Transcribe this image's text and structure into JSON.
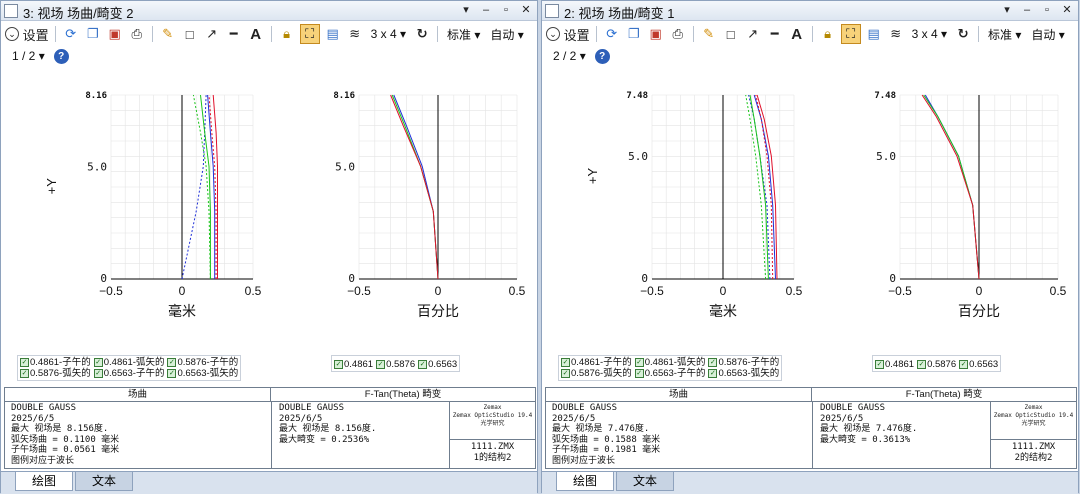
{
  "windows": [
    {
      "title": "3: 视场 场曲/畸变 2",
      "toolbar": {
        "settings_label": "设置",
        "grid_label": "3 x 4",
        "standard_label": "标准",
        "auto_label": "自动"
      },
      "page_label": "1 / 2",
      "plots": {
        "field_max_label": "8.16",
        "mid_label": "5.0",
        "zero_label": "0",
        "y_axis_label": "+Y",
        "left_xlabel": "毫米",
        "right_xlabel": "百分比",
        "tick_min": "−0.5",
        "tick_zero": "0",
        "tick_max": "0.5"
      },
      "legend_left": {
        "row1": [
          "0.4861-子午的",
          "0.4861-弧矢的",
          "0.5876-子午的"
        ],
        "row2": [
          "0.5876-弧矢的",
          "0.6563-子午的",
          "0.6563-弧矢的"
        ]
      },
      "legend_right": [
        "0.4861",
        "0.5876",
        "0.6563"
      ],
      "info": {
        "left_header": "场曲",
        "right_header": "F-Tan(Theta) 畸变",
        "left_lines": [
          "DOUBLE GAUSS",
          "2025/6/5",
          "最大 视场是 8.156度.",
          "弧矢场曲 = 0.1100 毫米",
          "子午场曲 = 0.0561 毫米",
          "图例对应于波长"
        ],
        "right_lines": [
          "DOUBLE GAUSS",
          "2025/6/5",
          "最大 视场是 8.156度.",
          "最大畸变 = 0.2536%"
        ],
        "logo_lines": [
          "Zemax",
          "Zemax OpticStudio 19.4",
          "光学研究"
        ],
        "file_lines": [
          "1111.ZMX",
          "1的结构2"
        ]
      },
      "tabs": [
        "绘图",
        "文本"
      ]
    },
    {
      "title": "2: 视场 场曲/畸变 1",
      "toolbar": {
        "settings_label": "设置",
        "grid_label": "3 x 4",
        "standard_label": "标准",
        "auto_label": "自动"
      },
      "page_label": "2 / 2",
      "plots": {
        "field_max_label": "7.48",
        "mid_label": "5.0",
        "zero_label": "0",
        "y_axis_label": "+Y",
        "left_xlabel": "毫米",
        "right_xlabel": "百分比",
        "tick_min": "−0.5",
        "tick_zero": "0",
        "tick_max": "0.5"
      },
      "legend_left": {
        "row1": [
          "0.4861-子午的",
          "0.4861-弧矢的",
          "0.5876-子午的"
        ],
        "row2": [
          "0.5876-弧矢的",
          "0.6563-子午的",
          "0.6563-弧矢的"
        ]
      },
      "legend_right": [
        "0.4861",
        "0.5876",
        "0.6563"
      ],
      "info": {
        "left_header": "场曲",
        "right_header": "F-Tan(Theta) 畸变",
        "left_lines": [
          "DOUBLE GAUSS",
          "2025/6/5",
          "最大 视场是 7.476度.",
          "弧矢场曲 = 0.1588 毫米",
          "子午场曲 = 0.1981 毫米",
          "图例对应于波长"
        ],
        "right_lines": [
          "DOUBLE GAUSS",
          "2025/6/5",
          "最大 视场是 7.476度.",
          "最大畸变 = 0.3613%"
        ],
        "logo_lines": [
          "Zemax",
          "Zemax OpticStudio 19.4",
          "光学研究"
        ],
        "file_lines": [
          "1111.ZMX",
          "2的结构2"
        ]
      },
      "tabs": [
        "绘图",
        "文本"
      ]
    }
  ],
  "colors": {
    "blue": "#1f2fd8",
    "green": "#19c419",
    "red": "#e0102a"
  },
  "chart_data": [
    {
      "type": "line",
      "title": "场曲",
      "xlabel": "毫米",
      "ylabel": "+Y",
      "xlim": [
        -0.5,
        0.5
      ],
      "ylim": [
        0,
        8.16
      ],
      "series": [
        {
          "name": "0.4861-子午的",
          "color": "#1f2fd8",
          "style": "dash",
          "x": [
            0.0,
            0.1,
            0.15,
            0.16,
            0.17
          ],
          "y": [
            0,
            3,
            5,
            6.5,
            8.16
          ]
        },
        {
          "name": "0.4861-弧矢的",
          "color": "#1f2fd8",
          "style": "solid",
          "x": [
            0.23,
            0.23,
            0.22,
            0.2,
            0.18
          ],
          "y": [
            0,
            3,
            5,
            6.5,
            8.16
          ]
        },
        {
          "name": "0.5876-子午的",
          "color": "#19c419",
          "style": "dash",
          "x": [
            0.2,
            0.19,
            0.17,
            0.13,
            0.08
          ],
          "y": [
            0,
            3,
            5,
            6.5,
            8.16
          ]
        },
        {
          "name": "0.5876-弧矢的",
          "color": "#19c419",
          "style": "solid",
          "x": [
            0.2,
            0.2,
            0.19,
            0.16,
            0.13
          ],
          "y": [
            0,
            3,
            5,
            6.5,
            8.16
          ]
        },
        {
          "name": "0.6563-子午的",
          "color": "#e0102a",
          "style": "dash",
          "x": [
            0.24,
            0.24,
            0.23,
            0.21,
            0.19
          ],
          "y": [
            0,
            3,
            5,
            6.5,
            8.16
          ]
        },
        {
          "name": "0.6563-弧矢的",
          "color": "#e0102a",
          "style": "solid",
          "x": [
            0.25,
            0.25,
            0.25,
            0.24,
            0.22
          ],
          "y": [
            0,
            3,
            5,
            6.5,
            8.16
          ]
        }
      ]
    },
    {
      "type": "line",
      "title": "F-Tan(Theta) 畸变",
      "xlabel": "百分比",
      "xlim": [
        -0.5,
        0.5
      ],
      "ylim": [
        0,
        8.16
      ],
      "series": [
        {
          "name": "0.4861",
          "color": "#1f2fd8",
          "x": [
            0,
            -0.03,
            -0.1,
            -0.2,
            -0.28
          ],
          "y": [
            0,
            3,
            5,
            6.8,
            8.16
          ]
        },
        {
          "name": "0.5876",
          "color": "#19c419",
          "x": [
            0,
            -0.03,
            -0.11,
            -0.21,
            -0.29
          ],
          "y": [
            0,
            3,
            5,
            6.8,
            8.16
          ]
        },
        {
          "name": "0.6563",
          "color": "#e0102a",
          "x": [
            0,
            -0.03,
            -0.11,
            -0.22,
            -0.3
          ],
          "y": [
            0,
            3,
            5,
            6.8,
            8.16
          ]
        }
      ]
    },
    {
      "type": "line",
      "title": "场曲",
      "xlabel": "毫米",
      "ylabel": "+Y",
      "xlim": [
        -0.5,
        0.5
      ],
      "ylim": [
        0,
        7.48
      ],
      "series": [
        {
          "name": "0.4861-子午的",
          "color": "#1f2fd8",
          "style": "dash",
          "x": [
            0.33,
            0.31,
            0.26,
            0.22,
            0.18
          ],
          "y": [
            0,
            3,
            5,
            6.5,
            7.48
          ]
        },
        {
          "name": "0.4861-弧矢的",
          "color": "#1f2fd8",
          "style": "solid",
          "x": [
            0.37,
            0.35,
            0.32,
            0.27,
            0.22
          ],
          "y": [
            0,
            3,
            5,
            6.5,
            7.48
          ]
        },
        {
          "name": "0.5876-子午的",
          "color": "#19c419",
          "style": "dash",
          "x": [
            0.3,
            0.27,
            0.23,
            0.19,
            0.16
          ],
          "y": [
            0,
            3,
            5,
            6.5,
            7.48
          ]
        },
        {
          "name": "0.5876-弧矢的",
          "color": "#19c419",
          "style": "solid",
          "x": [
            0.32,
            0.3,
            0.26,
            0.22,
            0.19
          ],
          "y": [
            0,
            3,
            5,
            6.5,
            7.48
          ]
        },
        {
          "name": "0.6563-子午的",
          "color": "#e0102a",
          "style": "dash",
          "x": [
            0.35,
            0.34,
            0.31,
            0.27,
            0.23
          ],
          "y": [
            0,
            3,
            5,
            6.5,
            7.48
          ]
        },
        {
          "name": "0.6563-弧矢的",
          "color": "#e0102a",
          "style": "solid",
          "x": [
            0.38,
            0.37,
            0.34,
            0.29,
            0.24
          ],
          "y": [
            0,
            3,
            5,
            6.5,
            7.48
          ]
        }
      ]
    },
    {
      "type": "line",
      "title": "F-Tan(Theta) 畸变",
      "xlabel": "百分比",
      "xlim": [
        -0.5,
        0.5
      ],
      "ylim": [
        0,
        7.48
      ],
      "series": [
        {
          "name": "0.4861",
          "color": "#1f2fd8",
          "x": [
            0,
            -0.04,
            -0.13,
            -0.26,
            -0.34
          ],
          "y": [
            0,
            3,
            5,
            6.6,
            7.48
          ]
        },
        {
          "name": "0.5876",
          "color": "#19c419",
          "x": [
            0,
            -0.04,
            -0.13,
            -0.26,
            -0.35
          ],
          "y": [
            0,
            3,
            5,
            6.6,
            7.48
          ]
        },
        {
          "name": "0.6563",
          "color": "#e0102a",
          "x": [
            0,
            -0.04,
            -0.14,
            -0.27,
            -0.36
          ],
          "y": [
            0,
            3,
            5,
            6.6,
            7.48
          ]
        }
      ]
    }
  ]
}
